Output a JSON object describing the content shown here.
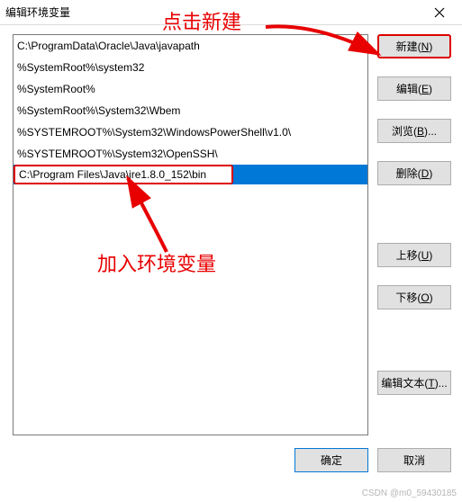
{
  "window": {
    "title": "编辑环境变量"
  },
  "list": {
    "items": [
      "C:\\ProgramData\\Oracle\\Java\\javapath",
      "%SystemRoot%\\system32",
      "%SystemRoot%",
      "%SystemRoot%\\System32\\Wbem",
      "%SYSTEMROOT%\\System32\\WindowsPowerShell\\v1.0\\",
      "%SYSTEMROOT%\\System32\\OpenSSH\\"
    ],
    "editing_value": "C:\\Program Files\\Java\\jre1.8.0_152\\bin"
  },
  "buttons": {
    "new": {
      "label": "新建",
      "accel": "N"
    },
    "edit": {
      "label": "编辑",
      "accel": "E"
    },
    "browse": {
      "label": "浏览",
      "accel": "B"
    },
    "delete": {
      "label": "删除",
      "accel": "D"
    },
    "moveup": {
      "label": "上移",
      "accel": "U"
    },
    "movedown": {
      "label": "下移",
      "accel": "O"
    },
    "edittext": {
      "label": "编辑文本",
      "accel": "T"
    },
    "ok": {
      "label": "确定"
    },
    "cancel": {
      "label": "取消"
    }
  },
  "annotations": {
    "top": "点击新建",
    "bottom": "加入环境变量",
    "watermark": "CSDN @m0_59430185"
  },
  "colors": {
    "highlight": "#e80000",
    "selection": "#0078d7",
    "button_bg": "#e1e1e1",
    "button_border": "#adadad"
  }
}
